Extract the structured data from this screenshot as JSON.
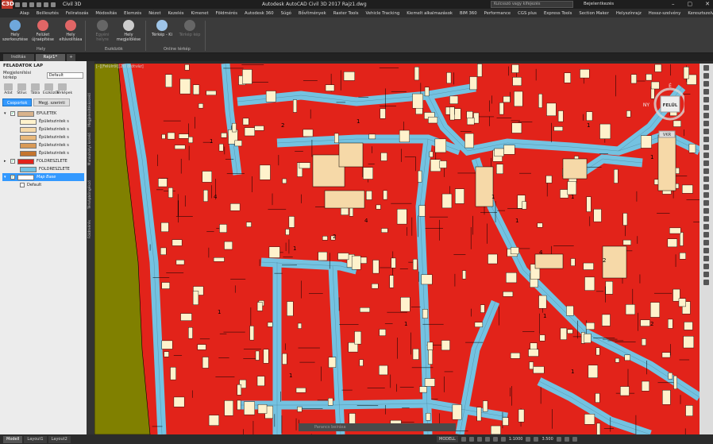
{
  "app": {
    "logo": "C3D",
    "workspace": "Civil 3D",
    "window_title": "Autodesk AutoCAD Civil 3D 2017   Rajz1.dwg",
    "search_placeholder": "Kulcsszó vagy kifejezés",
    "user": "Bejelentkezés",
    "minimize": "–",
    "maximize": "▢",
    "close": "✕"
  },
  "menu": [
    "Alap",
    "Beillesztés",
    "Feliratozás",
    "Módosítás",
    "Elemzés",
    "Nézet",
    "Kezelés",
    "Kimenet",
    "Földmérés",
    "Autodesk 360",
    "Súgó",
    "Bővítmények",
    "Raster Tools",
    "Vehicle Tracking",
    "Kiemelt alkalmazások",
    "BIM 360",
    "Performance",
    "CGS plus",
    "Express Tools",
    "Section Maker",
    "Helyszínrajz",
    "Hossz-szelvény",
    "Keresztszelvény"
  ],
  "ribbon": {
    "buttons": [
      {
        "label": "Hely szerkesztése",
        "disabled": false,
        "color": "#6fa8dc"
      },
      {
        "label": "Felület újraépítése",
        "disabled": false,
        "color": "#e06666"
      },
      {
        "label": "Hely eltávolítása",
        "disabled": false,
        "color": "#e06666"
      },
      {
        "label": "Egyéni helyre",
        "disabled": true,
        "color": "#666666"
      },
      {
        "label": "Hely megjelölése",
        "disabled": false,
        "color": "#cccccc"
      },
      {
        "label": "Térkép - Ki",
        "disabled": false,
        "color": "#9fc5e8"
      },
      {
        "label": "Térkép kép",
        "disabled": true,
        "color": "#666666"
      }
    ],
    "groups": [
      "Hely",
      "Eszközök",
      "Online térkép"
    ]
  },
  "doc_tabs": {
    "tab1": "Indítás",
    "tab2": "Rajz1*",
    "plus": "+"
  },
  "task_pane": {
    "title": "FELADATOK LAP",
    "view_label": "Megjelenítési térkép",
    "view_value": "Default",
    "tools": [
      "Adat",
      "Stílus",
      "Tábla",
      "Eszközök",
      "Térképek"
    ],
    "tab_groups": "Csoportok",
    "tab_order": "Megj. szerinti",
    "layers": [
      {
        "name": "EPULETEK",
        "color": "#d9b38c",
        "checked": true,
        "expand": "▾"
      },
      {
        "name": "Épületszintek s",
        "color": "#fff2cc",
        "checked": false,
        "expand": ""
      },
      {
        "name": "Épületszintek s",
        "color": "#f6d9a8",
        "checked": false,
        "expand": ""
      },
      {
        "name": "Épületszintek s",
        "color": "#e9b87a",
        "checked": false,
        "expand": ""
      },
      {
        "name": "Épületszintek s",
        "color": "#d99a57",
        "checked": false,
        "expand": ""
      },
      {
        "name": "Épületszintek s",
        "color": "#c4742e",
        "checked": false,
        "expand": ""
      },
      {
        "name": "FOLDRESZLETE",
        "color": "#e2231a",
        "checked": true,
        "expand": "▸"
      },
      {
        "name": "FOLDRESZLETE",
        "color": "#74c2e1",
        "checked": true,
        "expand": ""
      },
      {
        "name": "Map Base",
        "color": "#ffffff",
        "checked": true,
        "expand": "▾"
      },
      {
        "name": "Default",
        "color": "",
        "checked": false,
        "expand": ""
      }
    ],
    "side_tabs": [
      "Megjelenítéskezelő",
      "Munkahelyi kezelő",
      "Térképböngésző",
      "Földmérés"
    ]
  },
  "viewport_label": "[–][Felülről][2D drótváz]",
  "viewcube": {
    "north": "É",
    "top": "FELÜL",
    "west": "NY",
    "wcs": "VKR"
  },
  "command_line": "Parancs beírása",
  "layout_tabs": [
    "Modell",
    "Layout1",
    "Layout2"
  ],
  "status": {
    "model": "MODELL",
    "scale": "1:1000",
    "value": "3.500"
  },
  "parcel_numbers": [
    "1",
    "2",
    "1",
    "2",
    "4",
    "1",
    "1",
    "1",
    "4",
    "1",
    "1",
    "1",
    "2",
    "1",
    "1",
    "1",
    "4",
    "1",
    "1",
    "2"
  ],
  "colors": {
    "parcel": "#e2231a",
    "road": "#74c2e1",
    "building": "#fff2cc",
    "outer": "#808000",
    "line": "#000000"
  }
}
